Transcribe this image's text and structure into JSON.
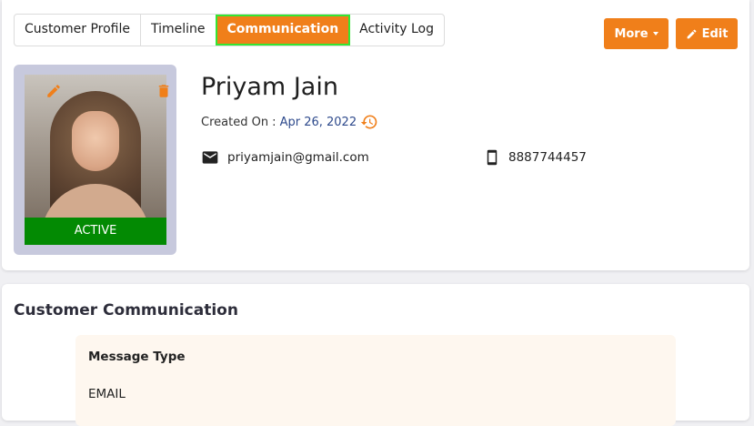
{
  "tabs": [
    {
      "label": "Customer Profile"
    },
    {
      "label": "Timeline"
    },
    {
      "label": "Communication"
    },
    {
      "label": "Activity Log"
    }
  ],
  "active_tab": "Communication",
  "buttons": {
    "more_label": "More",
    "edit_label": "Edit"
  },
  "profile": {
    "name": "Priyam Jain",
    "created_prefix": "Created On :",
    "created_date": "Apr 26, 2022",
    "status": "ACTIVE",
    "email": "priyamjain@gmail.com",
    "phone": "8887744457"
  },
  "communication": {
    "title": "Customer Communication",
    "message_type_label": "Message Type",
    "message_type_value": "EMAIL"
  },
  "colors": {
    "accent": "#f07f1a",
    "status_active": "#038a03",
    "active_tab_border": "#33e633"
  },
  "icons": [
    "pencil-icon",
    "trash-icon",
    "history-icon",
    "mail-icon",
    "mobile-phone-icon",
    "caret-down-icon"
  ]
}
